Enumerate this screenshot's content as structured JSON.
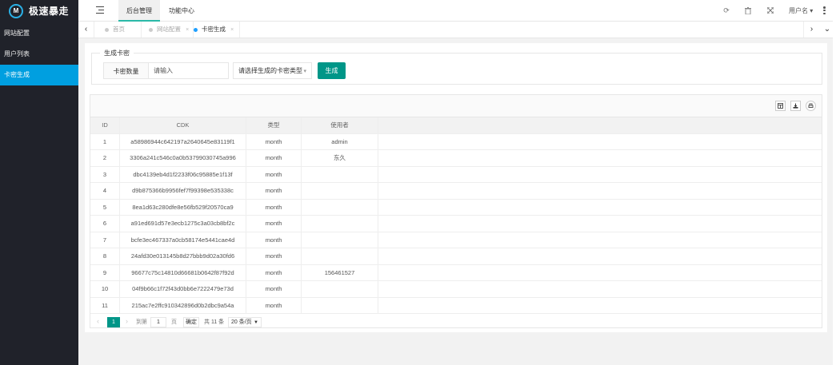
{
  "app": {
    "logo_mark": "M",
    "title": "极速暴走"
  },
  "sidebar": {
    "items": [
      {
        "label": "网站配置",
        "active": false
      },
      {
        "label": "用户列表",
        "active": false
      },
      {
        "label": "卡密生成",
        "active": true
      }
    ]
  },
  "header": {
    "tabs": [
      {
        "label": "后台管理",
        "active": true
      },
      {
        "label": "功能中心",
        "active": false
      }
    ],
    "icons": [
      "refresh-icon",
      "trash-icon",
      "fullscreen-icon"
    ],
    "icon_glyphs": {
      "refresh": "⟳",
      "trash": "🗑",
      "fullscreen": "⤢"
    },
    "user_name": "用户名",
    "user_caret": "▾"
  },
  "page_tabs": {
    "left_arrow": "‹",
    "right_arrow": "›",
    "down_arrow": "⌄",
    "items": [
      {
        "label": "首页",
        "closable": false,
        "active": false
      },
      {
        "label": "网站配置",
        "closable": true,
        "active": false
      },
      {
        "label": "卡密生成",
        "closable": true,
        "active": true
      }
    ],
    "close_glyph": "×"
  },
  "form": {
    "legend": "生成卡密",
    "quantity_label": "卡密数量",
    "quantity_placeholder": "请输入",
    "type_select_placeholder": "请选择生成的卡密类型",
    "select_caret": "▾",
    "generate_button": "生成"
  },
  "table": {
    "toolbar_icons": [
      "columns-filter-icon",
      "export-icon",
      "print-icon"
    ],
    "columns": {
      "id": "ID",
      "cdk": "CDK",
      "type": "类型",
      "user": "使用者"
    },
    "rows": [
      {
        "id": "1",
        "cdk": "a58986944c642197a2640645e83119f1",
        "type": "month",
        "user": "admin"
      },
      {
        "id": "2",
        "cdk": "3306a241c546c0a0b53799030745a996",
        "type": "month",
        "user": "东久"
      },
      {
        "id": "3",
        "cdk": "dbc4139eb4d1f2233f06c95885e1f13f",
        "type": "month",
        "user": ""
      },
      {
        "id": "4",
        "cdk": "d9b875366b9956fef7f99398e535338c",
        "type": "month",
        "user": ""
      },
      {
        "id": "5",
        "cdk": "8ea1d63c280dfe8e56fb529f20570ca9",
        "type": "month",
        "user": ""
      },
      {
        "id": "6",
        "cdk": "a91ed691d57e3ecb1275c3a03cb8bf2c",
        "type": "month",
        "user": ""
      },
      {
        "id": "7",
        "cdk": "bcfe3ec467337a0cb58174e5441cae4d",
        "type": "month",
        "user": ""
      },
      {
        "id": "8",
        "cdk": "24afd30e013145b8d27bbb9d02a30fd6",
        "type": "month",
        "user": ""
      },
      {
        "id": "9",
        "cdk": "96677c75c14810d66681b0642f87f92d",
        "type": "month",
        "user": "156461527"
      },
      {
        "id": "10",
        "cdk": "04f9b66c1f72f43d0bb6e7222479e73d",
        "type": "month",
        "user": ""
      },
      {
        "id": "11",
        "cdk": "215ac7e2ffc910342896d0b2dbc9a54a",
        "type": "month",
        "user": ""
      }
    ]
  },
  "pager": {
    "prev": "‹",
    "next": "›",
    "current": "1",
    "goto_label": "到第",
    "goto_value": "1",
    "page_unit": "页",
    "confirm": "确定",
    "total": "共 11 条",
    "page_size": "20 条/页",
    "size_caret": "▼"
  }
}
